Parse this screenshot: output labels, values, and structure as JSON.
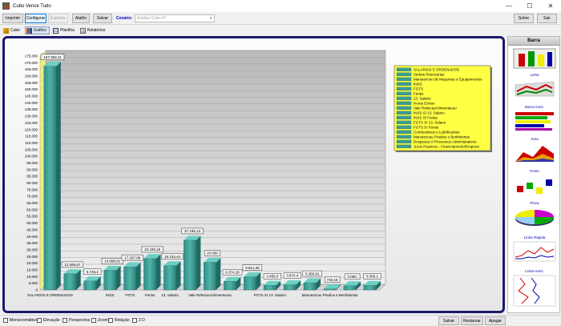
{
  "window": {
    "title": "Cubo Vence Tudo",
    "min_label": "—",
    "max_label": "☐",
    "close_label": "✕"
  },
  "toolbar": {
    "imprimir": "Imprimir",
    "configurar": "Configurar",
    "exportar": "Exportar",
    "atalho": "Atalho",
    "salvar": "Salvar",
    "cenario_label": "Cenário:",
    "cenario_value": "Análise Cubo 07",
    "sobre": "Sobre",
    "sair": "Sair"
  },
  "tabs": [
    {
      "label": "Cubo"
    },
    {
      "label": "Gráfico"
    },
    {
      "label": "Planilha"
    },
    {
      "label": "Relatórios"
    }
  ],
  "chart_data": {
    "type": "bar",
    "categories": [
      "SALARIOS E ORDENADOS",
      "Verbas Rescisorias",
      "Manutencao de Maquinas e Equipamentos",
      "INSS",
      "FGTS",
      "Ferias",
      "13. Salario",
      "Horas Extras",
      "Vale Refeicao/Alimentacao",
      "INSS S/ 13. Salario",
      "INSS S/ Ferias",
      "FGTS S/ 13. Salario",
      "FGTS S/ Ferias",
      "Combustiveis e Lubrificantes",
      "Manutencao Predios e Benfeitorias",
      "Despesas c/ Processos Administrativos",
      "Juros Passivos - Financiamento/Emprest"
    ],
    "values": [
      167363.11,
      12089.67,
      6746.2,
      14698.91,
      17297.88,
      23430.15,
      18153.44,
      37195.13,
      20650,
      6374.28,
      9821.39,
      3455.0,
      3874.4,
      5360.81,
      740.18,
      3080.0,
      3356.1
    ],
    "data_labels": [
      "167.363,11",
      "12.089,67",
      "6.746,2",
      "14.698,91",
      "17.297,88",
      "23.430,15",
      "18.153,44",
      "37.195,13",
      "20.650",
      "6.374,28",
      "9.821,39",
      "3.455,0",
      "3.874,4",
      "5.360,81",
      "740,18",
      "3.080,",
      "3.356,1"
    ],
    "x_tick_labels": [
      "SALARIOS E ORDENADOS",
      "",
      "",
      "INSS",
      "FGTS",
      "Ferias",
      "13. Salario",
      "",
      "Vale Refeicao/Alimentacao",
      "",
      "",
      "FGTS S/ 13. Salario",
      "",
      "",
      "Manutencao Predios e Benfeitorias",
      "",
      ""
    ],
    "y_ticks": [
      "0",
      "5.000",
      "10.000",
      "15.000",
      "20.000",
      "25.000",
      "30.000",
      "35.000",
      "40.000",
      "45.000",
      "50.000",
      "55.000",
      "60.000",
      "65.000",
      "70.000",
      "75.000",
      "80.000",
      "85.000",
      "90.000",
      "95.000",
      "100.000",
      "105.000",
      "110.000",
      "115.000",
      "120.000",
      "125.000",
      "130.000",
      "135.000",
      "140.000",
      "145.000",
      "150.000",
      "155.000",
      "160.000",
      "165.000",
      "170.000",
      "175.000"
    ],
    "ylim": [
      0,
      175000
    ],
    "legend_position": "top-right",
    "bar_color": "#3a9e94",
    "legend_bg": "#ffff44",
    "grid": true
  },
  "chart_types": {
    "header": "Barra",
    "items": [
      {
        "label": "Linha"
      },
      {
        "label": "Barra Horiz."
      },
      {
        "label": "Área"
      },
      {
        "label": "Ponto"
      },
      {
        "label": "Pizza"
      },
      {
        "label": "Linha Rápida"
      },
      {
        "label": "Linha Horiz."
      }
    ]
  },
  "status": {
    "checks": [
      "Monocromático",
      "Elevação",
      "Perspectiva",
      "Zoom",
      "Rotação",
      "3 D"
    ],
    "salvar": "Salvar",
    "restaurar": "Restaurar",
    "apagar": "Apagar"
  }
}
